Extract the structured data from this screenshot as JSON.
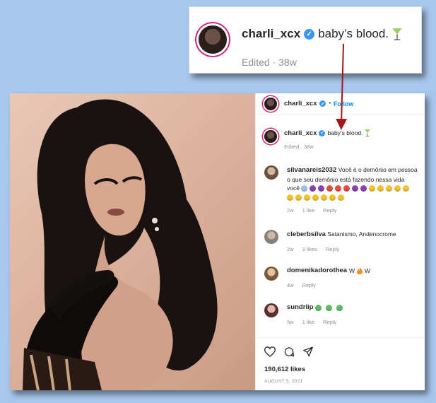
{
  "zoom": {
    "username": "charli_xcx",
    "caption": "baby’s blood.",
    "edited": "Edited · 38w"
  },
  "post": {
    "header": {
      "username": "charli_xcx",
      "dot": "•",
      "follow": "Follow"
    },
    "caption": {
      "username": "charli_xcx",
      "text": "baby’s blood.",
      "edited": "Edited · 38w"
    },
    "comments": [
      {
        "username": "silvanareis2032",
        "text": "Você é o demônio em pessoa",
        "text2": "o que seu demônio está fazendo nessa vida",
        "text3": "você",
        "age": "2w",
        "likes": "1 like",
        "reply": "Reply"
      },
      {
        "username": "cleberbsilva",
        "text": "Satanismo, Andenocrome",
        "age": "2w",
        "likes": "3 likes",
        "reply": "Reply"
      },
      {
        "username": "domenikadorothea",
        "text": "W",
        "text_after": "W",
        "age": "4w",
        "reply": "Reply"
      },
      {
        "username": "sundriip",
        "age": "5w",
        "likes": "1 like",
        "reply": "Reply"
      }
    ],
    "likes": "190,612 likes",
    "date": "AUGUST 5, 2021"
  },
  "colors": {
    "background": "#a9c7ee",
    "verified": "#3897f0",
    "follow": "#0095f6",
    "arrow": "#a01818"
  },
  "icons": [
    "verified-badge",
    "cocktail-icon",
    "heart-icon",
    "comment-icon",
    "share-icon",
    "fire-icon"
  ]
}
